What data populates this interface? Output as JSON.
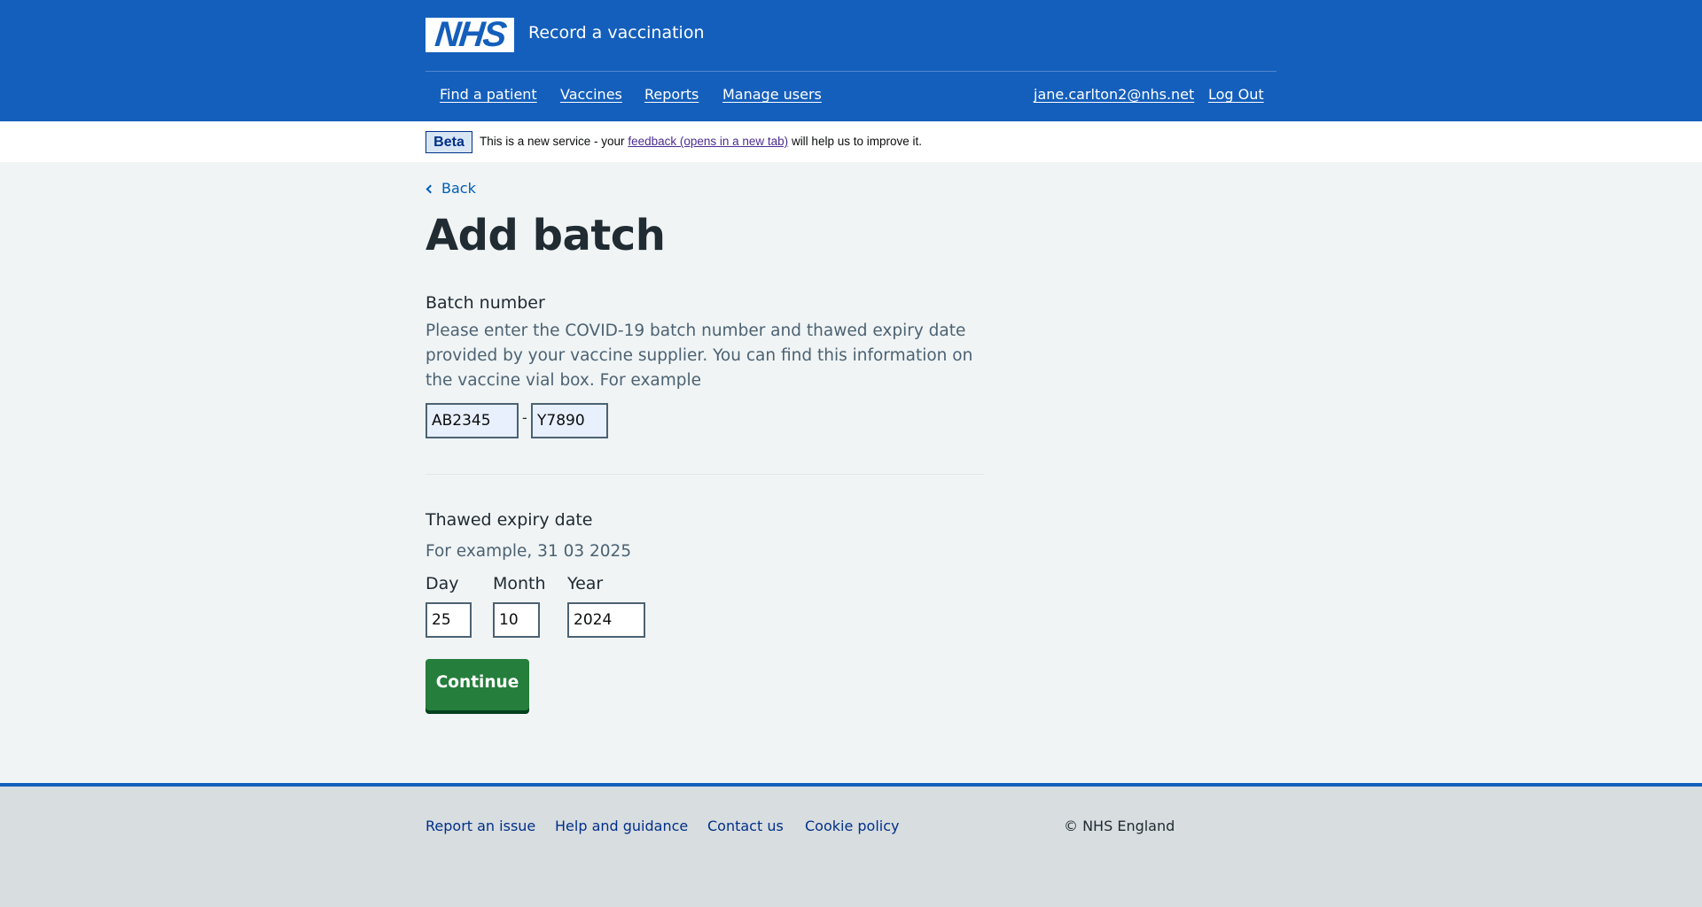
{
  "header": {
    "logo_text": "NHS",
    "service_name": "Record a vaccination",
    "nav": [
      {
        "label": "Find a patient"
      },
      {
        "label": "Vaccines"
      },
      {
        "label": "Reports"
      },
      {
        "label": "Manage users"
      }
    ],
    "user_email": "jane.carlton2@nhs.net",
    "logout_label": "Log Out"
  },
  "beta": {
    "tag": "Beta",
    "text_before": "This is a new service - your ",
    "link_text": "feedback (opens in a new tab)",
    "text_after": " will help us to improve it."
  },
  "main": {
    "back_label": "Back",
    "title": "Add batch",
    "batch": {
      "label": "Batch number",
      "hint": "Please enter the COVID-19 batch number and thawed expiry date provided by your vaccine supplier. You can find this information on the vaccine vial box. For example",
      "prefix_value": "AB2345",
      "separator": "-",
      "suffix_value": "Y7890"
    },
    "expiry": {
      "label": "Thawed expiry date",
      "hint": "For example, 31 03 2025",
      "day_label": "Day",
      "month_label": "Month",
      "year_label": "Year",
      "day_value": "25",
      "month_value": "10",
      "year_value": "2024"
    },
    "continue_label": "Continue"
  },
  "footer": {
    "links": [
      {
        "label": "Report an issue"
      },
      {
        "label": "Help and guidance"
      },
      {
        "label": "Contact us"
      },
      {
        "label": "Cookie policy"
      }
    ],
    "copyright": "© NHS England"
  },
  "colors": {
    "header_blue": "#145fbc",
    "button_green": "#257e3b",
    "link_blue": "#005eb8",
    "footer_grey": "#d8dde0",
    "page_bg": "#f0f4f5"
  }
}
